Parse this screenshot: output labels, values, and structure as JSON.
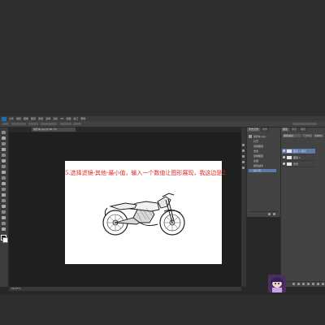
{
  "app": {
    "menu": [
      "PS",
      "文件",
      "编辑",
      "图像",
      "图层",
      "类型",
      "选择",
      "滤镜",
      "3D",
      "视图",
      "窗口",
      "帮助"
    ],
    "document_tab": "摩托车.jpg @ 66.7%"
  },
  "canvas": {
    "caption": "5.选择滤镜-其他-最小值，输入一个数值让图形展现，我这边是2"
  },
  "status": {
    "zoom": "66.67%"
  },
  "history_panel": {
    "tabs": [
      "历史记录",
      "动作"
    ],
    "items": [
      {
        "label": "摩托车.jpg",
        "state": "normal"
      },
      {
        "label": "打开",
        "state": "normal"
      },
      {
        "label": "复制图层",
        "state": "normal"
      },
      {
        "label": "去色",
        "state": "normal"
      },
      {
        "label": "复制图层",
        "state": "normal"
      },
      {
        "label": "反相",
        "state": "normal"
      },
      {
        "label": "颜色减淡",
        "state": "normal"
      },
      {
        "label": "最小值",
        "state": "selected"
      }
    ]
  },
  "layers_panel": {
    "tabs": [
      "图层",
      "通道",
      "路径"
    ],
    "blend_mode": "颜色减淡",
    "opacity_label": "不透明度",
    "opacity": "100%",
    "layers": [
      {
        "label": "图层 1 拷贝",
        "state": "selected"
      },
      {
        "label": "图层 1",
        "state": "normal"
      },
      {
        "label": "背景",
        "state": "normal"
      }
    ]
  },
  "colors": {
    "caption": "#e0261f",
    "selection": "#5d7aa8",
    "ps_blue": "#1e6cc0"
  }
}
